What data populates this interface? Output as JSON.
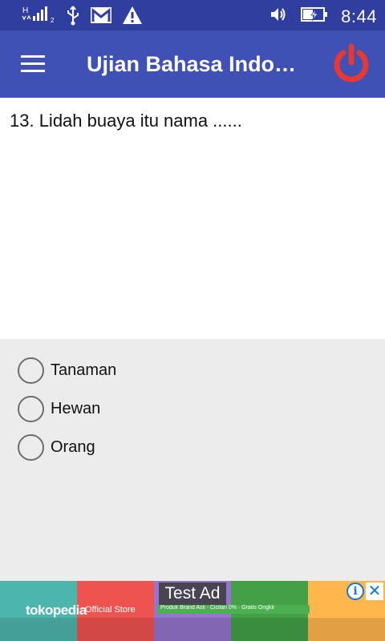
{
  "status_bar": {
    "network_label": "H",
    "sim_label": "2",
    "time": "8:44",
    "icons": [
      "signal-icon",
      "usb-icon",
      "gmail-icon",
      "warning-icon",
      "volume-icon",
      "battery-charging-icon"
    ]
  },
  "app_bar": {
    "title": "Ujian Bahasa Indo…",
    "menu_icon": "hamburger-menu-icon",
    "power_icon": "power-icon",
    "power_color": "#e53935"
  },
  "question": {
    "text": "13. Lidah buaya itu nama ......"
  },
  "options": [
    {
      "label": "Tanaman",
      "selected": false
    },
    {
      "label": "Hewan",
      "selected": false
    },
    {
      "label": "Orang",
      "selected": false
    }
  ],
  "ad": {
    "label": "Test Ad",
    "brand": "tokopedia",
    "store_text": "Official Store",
    "strip_text": "Produk Brand Asli · Cicilan 0% · Gratis Ongkir",
    "info_icon": "info-icon",
    "close_icon": "close-icon"
  },
  "colors": {
    "status_bar": "#303f9f",
    "app_bar": "#3f51b5",
    "options_background": "#ececec"
  }
}
